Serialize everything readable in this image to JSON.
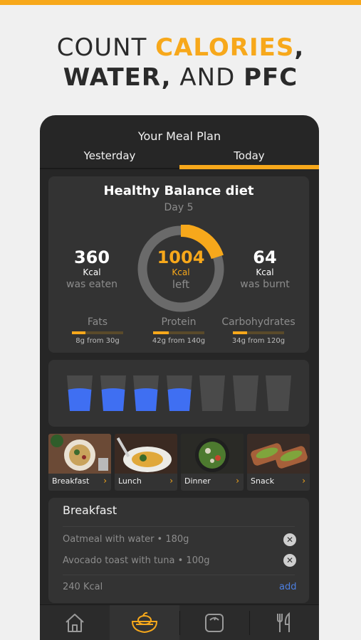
{
  "headline": {
    "line1_a": "COUNT ",
    "line1_b": "CALORIES",
    "line1_c": ",",
    "line2_a": "WATER,",
    "line2_b": " AND ",
    "line2_c": "PFC"
  },
  "colors": {
    "accent": "#f7a81b",
    "water": "#3f6ff2",
    "background": "#262626",
    "link": "#4d7fe0"
  },
  "app": {
    "title": "Your Meal Plan",
    "tabs": [
      {
        "label": "Yesterday",
        "selected": false
      },
      {
        "label": "Today",
        "selected": true
      }
    ]
  },
  "diet": {
    "name": "Healthy Balance diet",
    "day": "Day 5",
    "eaten": {
      "value": "360",
      "unit": "Kcal",
      "label": "was eaten"
    },
    "left": {
      "value": "1004",
      "unit": "Kcal",
      "label": "left",
      "ring_fraction": 0.2
    },
    "burnt": {
      "value": "64",
      "unit": "Kcal",
      "label": "was burnt"
    },
    "macros": [
      {
        "name": "Fats",
        "amount": "8g from 30g",
        "fraction": 0.27
      },
      {
        "name": "Protein",
        "amount": "42g from 140g",
        "fraction": 0.3
      },
      {
        "name": "Carbohydrates",
        "amount": "34g from 120g",
        "fraction": 0.28
      }
    ]
  },
  "water": {
    "glasses_total": 7,
    "glasses_filled": 4
  },
  "meals": [
    {
      "label": "Breakfast",
      "icon": "chevron-right-icon"
    },
    {
      "label": "Lunch",
      "icon": "chevron-right-icon"
    },
    {
      "label": "Dinner",
      "icon": "chevron-right-icon"
    },
    {
      "label": "Snack",
      "icon": "chevron-right-icon"
    }
  ],
  "breakfast": {
    "title": "Breakfast",
    "items": [
      {
        "name": "Oatmeal with water • 180g",
        "remove_icon": "close-icon"
      },
      {
        "name": "Avocado toast with tuna  • 100g",
        "remove_icon": "close-icon"
      }
    ],
    "total": "240 Kcal",
    "add_label": "add"
  },
  "nav": [
    {
      "icon": "home-icon"
    },
    {
      "icon": "meal-plan-icon",
      "active": true
    },
    {
      "icon": "scale-icon"
    },
    {
      "icon": "fork-knife-icon"
    }
  ]
}
